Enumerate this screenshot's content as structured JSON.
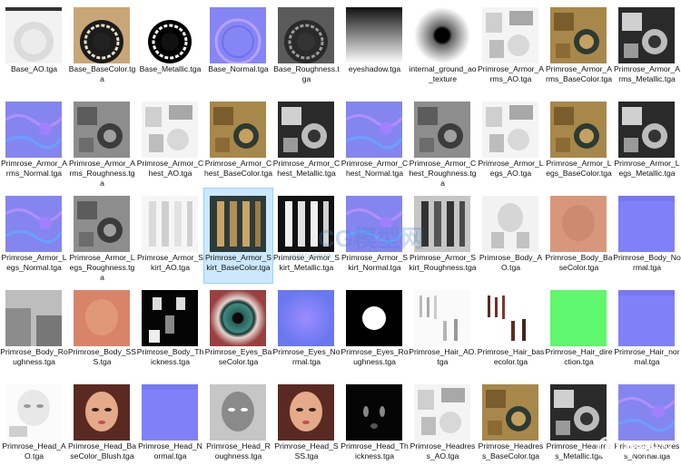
{
  "files": [
    {
      "label": "Base_AO.tga",
      "thumb": "ao-round"
    },
    {
      "label": "Base_BaseColor.tga",
      "thumb": "basecolor-round"
    },
    {
      "label": "Base_Metallic.tga",
      "thumb": "metallic-round"
    },
    {
      "label": "Base_Normal.tga",
      "thumb": "normal-round"
    },
    {
      "label": "Base_Roughness.tga",
      "thumb": "roughness-round"
    },
    {
      "label": "eyeshadow.tga",
      "thumb": "gradient"
    },
    {
      "label": "internal_ground_ao_texture",
      "thumb": "spot"
    },
    {
      "label": "Primrose_Armor_Arms_AO.tga",
      "thumb": "ao-armor"
    },
    {
      "label": "Primrose_Armor_Arms_BaseColor.tga",
      "thumb": "gold-armor"
    },
    {
      "label": "Primrose_Armor_Arms_Metallic.tga",
      "thumb": "metal-armor"
    },
    {
      "label": "Primrose_Armor_Arms_Normal.tga",
      "thumb": "normal"
    },
    {
      "label": "Primrose_Armor_Arms_Roughness.tga",
      "thumb": "gray-armor"
    },
    {
      "label": "Primrose_Armor_Chest_AO.tga",
      "thumb": "ao-armor"
    },
    {
      "label": "Primrose_Armor_Chest_BaseColor.tga",
      "thumb": "gold-armor"
    },
    {
      "label": "Primrose_Armor_Chest_Metallic.tga",
      "thumb": "metal-armor"
    },
    {
      "label": "Primrose_Armor_Chest_Normal.tga",
      "thumb": "normal"
    },
    {
      "label": "Primrose_Armor_Chest_Roughness.tga",
      "thumb": "gray-armor"
    },
    {
      "label": "Primrose_Armor_Legs_AO.tga",
      "thumb": "ao-armor"
    },
    {
      "label": "Primrose_Armor_Legs_BaseColor.tga",
      "thumb": "gold-armor"
    },
    {
      "label": "Primrose_Armor_Legs_Metallic.tga",
      "thumb": "metal-armor"
    },
    {
      "label": "Primrose_Armor_Legs_Normal.tga",
      "thumb": "normal"
    },
    {
      "label": "Primrose_Armor_Legs_Roughness.tga",
      "thumb": "gray-armor"
    },
    {
      "label": "Primrose_Armor_Skirt_AO.tga",
      "thumb": "skirt-ao"
    },
    {
      "label": "Primrose_Armor_Skirt_BaseColor.tga",
      "thumb": "skirt-color",
      "selected": true
    },
    {
      "label": "Primrose_Armor_Skirt_Metallic.tga",
      "thumb": "skirt-metal"
    },
    {
      "label": "Primrose_Armor_Skirt_Normal.tga",
      "thumb": "normal"
    },
    {
      "label": "Primrose_Armor_Skirt_Roughness.tga",
      "thumb": "skirt-rough"
    },
    {
      "label": "Primrose_Body_AO.tga",
      "thumb": "body-ao"
    },
    {
      "label": "Primrose_Body_BaseColor.tga",
      "thumb": "skin"
    },
    {
      "label": "Primrose_Body_Normal.tga",
      "thumb": "flat-normal"
    },
    {
      "label": "Primrose_Body_Roughness.tga",
      "thumb": "body-rough"
    },
    {
      "label": "Primrose_Body_SSS.tga",
      "thumb": "skin-sss"
    },
    {
      "label": "Primrose_Body_Thickness.tga",
      "thumb": "thickness"
    },
    {
      "label": "Primrose_Eyes_BaseColor.tga",
      "thumb": "eye"
    },
    {
      "label": "Primrose_Eyes_Normal.tga",
      "thumb": "eye-normal"
    },
    {
      "label": "Primrose_Eyes_Roughness.tga",
      "thumb": "eye-rough"
    },
    {
      "label": "Primrose_Hair_AO.tga",
      "thumb": "hair-ao"
    },
    {
      "label": "Primrose_Hair_basecolor.tga",
      "thumb": "hair-color"
    },
    {
      "label": "Primrose_Hair_direction.tga",
      "thumb": "green"
    },
    {
      "label": "Primrose_Hair_normal.tga",
      "thumb": "flat-normal"
    },
    {
      "label": "Primrose_Head_AO.tga",
      "thumb": "head-ao"
    },
    {
      "label": "Primrose_Head_BaseColor_Blush.tga",
      "thumb": "head-color"
    },
    {
      "label": "Primrose_Head_Normal.tga",
      "thumb": "flat-normal"
    },
    {
      "label": "Primrose_Head_Roughness.tga",
      "thumb": "head-rough"
    },
    {
      "label": "Primrose_Head_SSS.tga",
      "thumb": "head-color"
    },
    {
      "label": "Primrose_Head_Thickness.tga",
      "thumb": "head-thick"
    },
    {
      "label": "Primrose_Headress_AO.tga",
      "thumb": "ao-armor"
    },
    {
      "label": "Primrose_Headress_BaseColor.tga",
      "thumb": "gold-armor"
    },
    {
      "label": "Primrose_Headress_Metallic.tga",
      "thumb": "metal-armor"
    },
    {
      "label": "Primrose_Headress_Normal.tga",
      "thumb": "normal"
    }
  ],
  "watermark": {
    "text": "CG模型网",
    "tiny": "yimo.com",
    "corner": "游戏社区"
  },
  "colors": {
    "selection": "#cce8ff",
    "normal": "#8080ff",
    "gold": "#a8874a"
  }
}
